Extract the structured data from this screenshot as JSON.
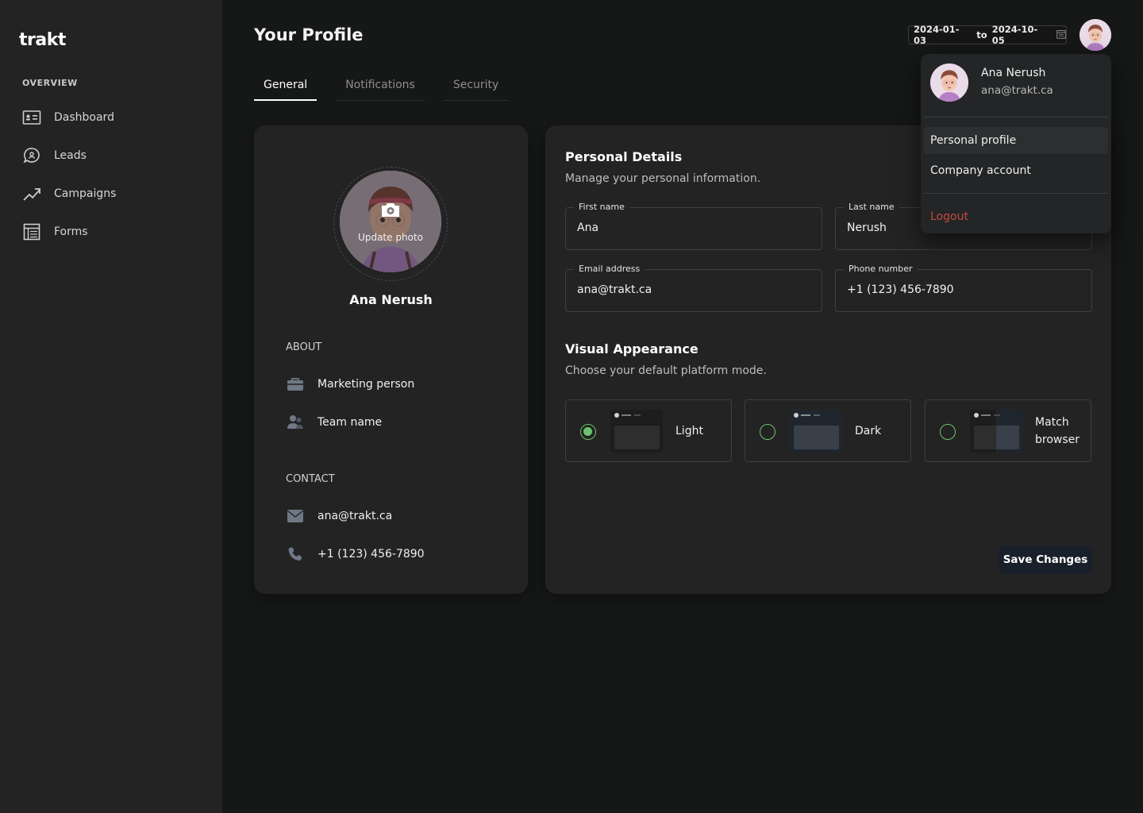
{
  "app": {
    "logo": "trakt"
  },
  "sidebar": {
    "section": "OVERVIEW",
    "items": [
      {
        "label": "Dashboard",
        "icon": "dashboard-icon"
      },
      {
        "label": "Leads",
        "icon": "leads-icon"
      },
      {
        "label": "Campaigns",
        "icon": "campaigns-icon"
      },
      {
        "label": "Forms",
        "icon": "forms-icon"
      }
    ]
  },
  "header": {
    "title": "Your Profile",
    "date_from": "2024-01-03",
    "date_to_label": "to",
    "date_to": "2024-10-05"
  },
  "tabs": [
    {
      "label": "General",
      "active": true
    },
    {
      "label": "Notifications",
      "active": false
    },
    {
      "label": "Security",
      "active": false
    }
  ],
  "profile_card": {
    "update_photo": "Update photo",
    "name": "Ana Nerush",
    "about_heading": "ABOUT",
    "about": [
      {
        "icon": "briefcase-icon",
        "text": "Marketing person"
      },
      {
        "icon": "team-icon",
        "text": "Team name"
      }
    ],
    "contact_heading": "CONTACT",
    "contact": [
      {
        "icon": "mail-icon",
        "text": "ana@trakt.ca"
      },
      {
        "icon": "phone-icon",
        "text": "+1 (123) 456-7890"
      }
    ]
  },
  "personal_details": {
    "title": "Personal Details",
    "subtitle": "Manage your personal information.",
    "fields": {
      "first_name": {
        "label": "First name",
        "value": "Ana"
      },
      "last_name": {
        "label": "Last name",
        "value": "Nerush"
      },
      "email": {
        "label": "Email address",
        "value": "ana@trakt.ca"
      },
      "phone": {
        "label": "Phone number",
        "value": "+1 (123) 456-7890"
      }
    }
  },
  "appearance": {
    "title": "Visual Appearance",
    "subtitle": "Choose your default platform mode.",
    "modes": [
      {
        "label": "Light",
        "selected": true
      },
      {
        "label": "Dark",
        "selected": false
      },
      {
        "label_line1": "Match",
        "label_line2": "browser",
        "selected": false
      }
    ]
  },
  "save_label": "Save Changes",
  "dropdown": {
    "name": "Ana Nerush",
    "email": "ana@trakt.ca",
    "items": [
      "Personal profile",
      "Company account"
    ],
    "logout": "Logout"
  },
  "colors": {
    "accent_green": "#6cc26f",
    "logout_red": "#c54a42",
    "background": "#161817",
    "sidebar": "#232323"
  }
}
